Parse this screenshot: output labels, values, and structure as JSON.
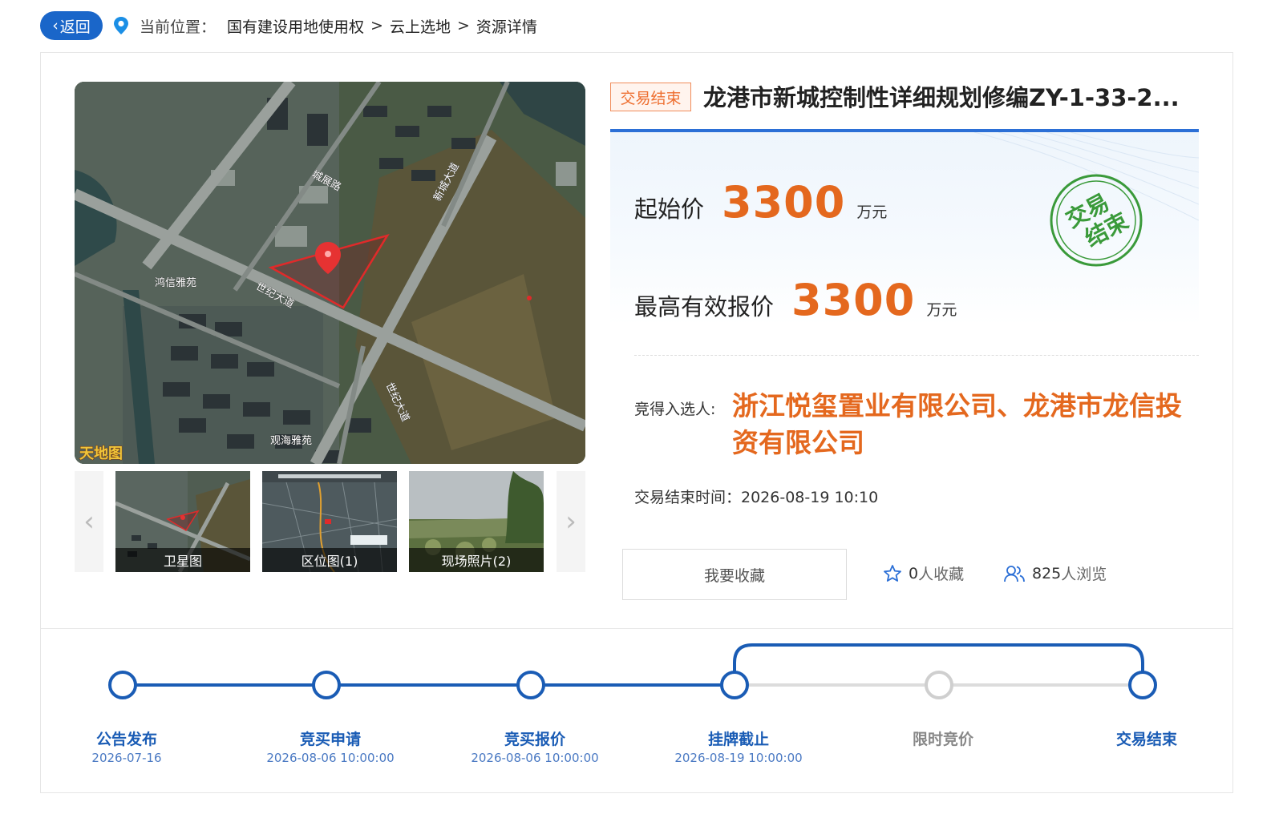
{
  "breadcrumb": {
    "back_label": "返回",
    "location_label": "当前位置：",
    "items": [
      "国有建设用地使用权",
      "云上选地",
      "资源详情"
    ]
  },
  "gallery": {
    "map_labels": [
      "天地图",
      "鸿信雅苑",
      "世纪大道",
      "城展路",
      "新城大道",
      "观海雅苑",
      "世纪大道"
    ],
    "thumbnails": [
      {
        "caption": "卫星图"
      },
      {
        "caption": "区位图(1)"
      },
      {
        "caption": "现场照片(2)"
      }
    ]
  },
  "listing": {
    "status_tag": "交易结束",
    "title": "龙港市新城控制性详细规划修编ZY-1-33-2...",
    "start_price_label": "起始价",
    "start_price": "3300",
    "start_price_unit": "万元",
    "top_bid_label": "最高有效报价",
    "top_bid": "3300",
    "top_bid_unit": "万元",
    "stamp_text": [
      "交易",
      "结束"
    ],
    "winner_label": "竞得入选人:",
    "winner": "浙江悦玺置业有限公司、龙港市龙信投资有限公司",
    "end_time": "交易结束时间：2026-08-19 10:10",
    "favorite_button": "我要收藏",
    "favorites_count": "0",
    "favorites_suffix": "人收藏",
    "views_count": "825",
    "views_suffix": "人浏览"
  },
  "progress": {
    "steps": [
      {
        "label": "公告发布",
        "date": "2026-07-16",
        "done": true
      },
      {
        "label": "竞买申请",
        "date": "2026-08-06 10:00:00",
        "done": true
      },
      {
        "label": "竞买报价",
        "date": "2026-08-06 10:00:00",
        "done": true
      },
      {
        "label": "挂牌截止",
        "date": "2026-08-19 10:00:00",
        "done": true
      },
      {
        "label": "限时竞价",
        "date": "",
        "done": false
      },
      {
        "label": "交易结束",
        "date": "",
        "done": true
      }
    ]
  },
  "colors": {
    "primary_blue": "#1a5cb5",
    "accent_orange": "#e4681e",
    "stamp_green": "#3a9a3a"
  }
}
